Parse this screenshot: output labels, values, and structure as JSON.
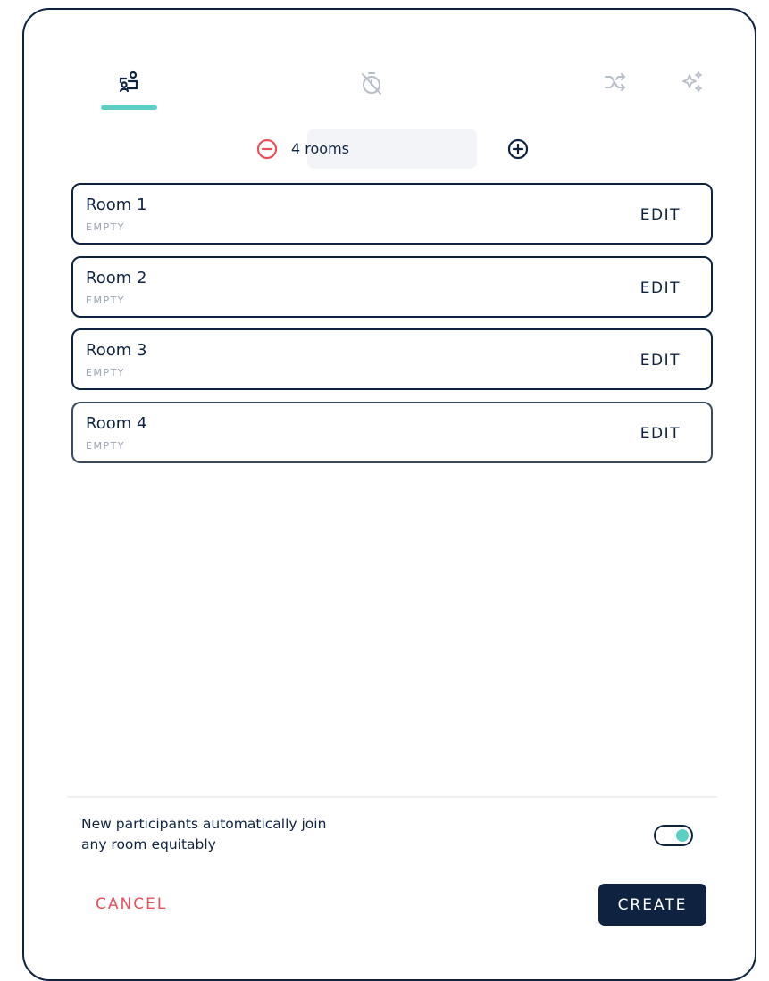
{
  "tabs": [
    {
      "name": "rooms",
      "icon": "rooms-assign-icon",
      "active": true
    },
    {
      "name": "timer",
      "icon": "timer-off-icon",
      "active": false
    },
    {
      "name": "shuffle",
      "icon": "shuffle-icon",
      "active": false
    },
    {
      "name": "auto",
      "icon": "sparkles-icon",
      "active": false
    }
  ],
  "room_counter": {
    "value": "4 rooms",
    "decrease_icon": "minus-circle-icon",
    "increase_icon": "plus-circle-icon"
  },
  "rooms": [
    {
      "name": "Room 1",
      "status": "EMPTY",
      "edit_label": "EDIT"
    },
    {
      "name": "Room 2",
      "status": "EMPTY",
      "edit_label": "EDIT"
    },
    {
      "name": "Room 3",
      "status": "EMPTY",
      "edit_label": "EDIT"
    },
    {
      "name": "Room 4",
      "status": "EMPTY",
      "edit_label": "EDIT"
    }
  ],
  "auto_join": {
    "label_line1": "New participants automatically join",
    "label_line2": "any room equitably",
    "enabled": true
  },
  "footer": {
    "cancel_label": "CANCEL",
    "create_label": "CREATE"
  },
  "colors": {
    "navy": "#0f2340",
    "accent": "#5ccfc4",
    "danger": "#e8505b",
    "muted": "#98a2b0",
    "inactive_icon": "#b8bec8"
  }
}
